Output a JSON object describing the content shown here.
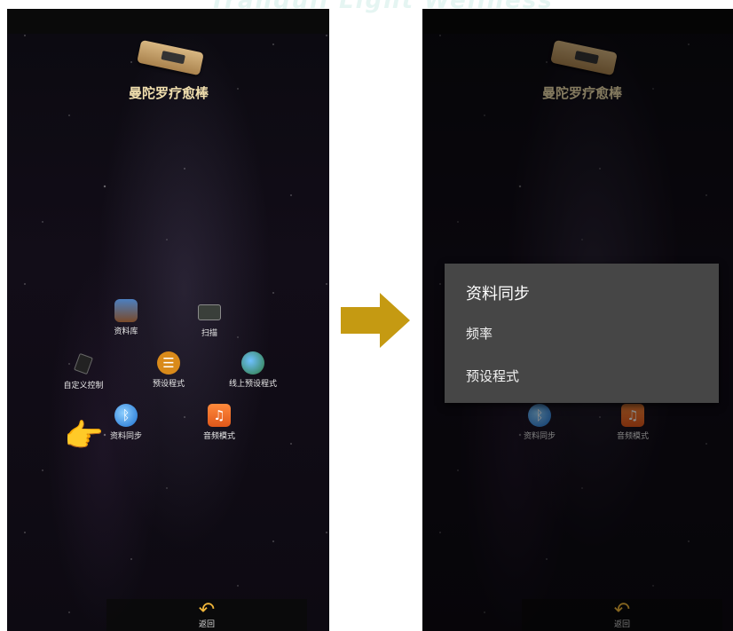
{
  "banner": "Tranquil Light Wellness",
  "app": {
    "title": "曼陀罗疗愈棒"
  },
  "menu": {
    "items": [
      {
        "label": "资料库",
        "icon": "books-icon"
      },
      {
        "label": "扫描",
        "icon": "scanner-icon"
      },
      {
        "label": "自定义控制",
        "icon": "remote-control-icon"
      },
      {
        "label": "预设程式",
        "icon": "sliders-icon"
      },
      {
        "label": "线上预设程式",
        "icon": "globe-icon"
      },
      {
        "label": "资料同步",
        "icon": "bluetooth-icon"
      },
      {
        "label": "音频模式",
        "icon": "music-note-icon"
      }
    ]
  },
  "back": {
    "label": "返回",
    "icon": "back-arrow-icon"
  },
  "dialog": {
    "title": "资料同步",
    "options": [
      "频率",
      "预设程式"
    ]
  },
  "colors": {
    "arrow": "#c59a12",
    "dialog_bg": "#464646",
    "title_gold": "#f1dfae"
  }
}
